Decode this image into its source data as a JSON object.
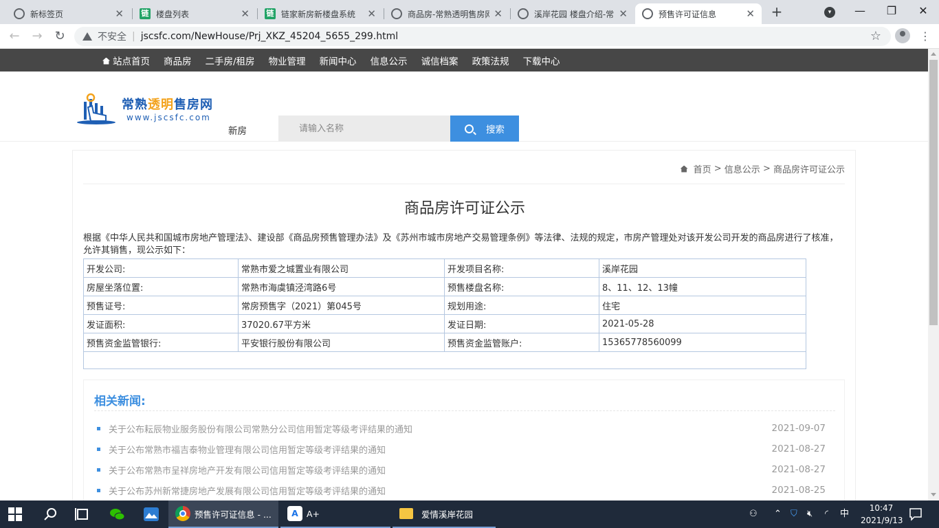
{
  "browser": {
    "tabs": [
      {
        "title": "新标签页",
        "favicon": "chrome-icon"
      },
      {
        "title": "楼盘列表",
        "favicon": "sheet-icon"
      },
      {
        "title": "链家新房新楼盘系统",
        "favicon": "sheet-icon"
      },
      {
        "title": "商品房-常熟透明售房网",
        "favicon": "globe-icon"
      },
      {
        "title": "溪岸花园 楼盘介绍-常",
        "favicon": "globe-icon"
      },
      {
        "title": "预售许可证信息",
        "favicon": "globe-icon"
      }
    ],
    "new_tab_label": "+",
    "security_label": "不安全",
    "url": "jscsfc.com/NewHouse/Prj_XKZ_45204_5655_299.html"
  },
  "site": {
    "nav": [
      "站点首页",
      "商品房",
      "二手房/租房",
      "物业管理",
      "新闻中心",
      "信息公示",
      "诚信档案",
      "政策法规",
      "下载中心"
    ],
    "title_a": "常熟",
    "title_b": "透明",
    "title_c": "售房网",
    "url_text": "www.jscsfc.com",
    "subtitle": "新房",
    "search_placeholder": "请输入名称",
    "search_button": "搜索",
    "accent": "#3d8fe0"
  },
  "breadcrumb": [
    "首页",
    "信息公示",
    "商品房许可证公示"
  ],
  "page_title": "商品房许可证公示",
  "intro": "根据《中华人民共和国城市房地产管理法》、建设部《商品房预售管理办法》及《苏州市城市房地产交易管理条例》等法律、法规的规定，市房产管理处对该开发公司开发的商品房进行了核准，允许其销售，现公示如下：",
  "permit": [
    [
      "开发公司:",
      "常熟市爱之城置业有限公司",
      "开发项目名称:",
      "溪岸花园"
    ],
    [
      "房屋坐落位置:",
      "常熟市海虞镇泾湾路6号",
      "预售楼盘名称:",
      "8、11、12、13幢"
    ],
    [
      "预售证号:",
      "常房预售字（2021）第045号",
      "规划用途:",
      "住宅"
    ],
    [
      "发证面积:",
      "37020.67平方米",
      "发证日期:",
      "2021-05-28"
    ],
    [
      "预售资金监管银行:",
      "平安银行股份有限公司",
      "预售资金监管账户:",
      "15365778560099"
    ]
  ],
  "related": {
    "title": "相关新闻:",
    "items": [
      {
        "title": "关于公布耘辰物业服务股份有限公司常熟分公司信用暂定等级考评结果的通知",
        "date": "2021-09-07"
      },
      {
        "title": "关于公布常熟市福吉泰物业管理有限公司信用暂定等级考评结果的通知",
        "date": "2021-08-27"
      },
      {
        "title": "关于公布常熟市呈祥房地产开发有限公司信用暂定等级考评结果的通知",
        "date": "2021-08-27"
      },
      {
        "title": "关于公布苏州新常捷房地产发展有限公司信用暂定等级考评结果的通知",
        "date": "2021-08-25"
      }
    ]
  },
  "taskbar": {
    "apps": [
      {
        "label": "预售许可证信息 - ..."
      },
      {
        "label": "A+"
      },
      {
        "label": "爱情溪岸花园"
      }
    ],
    "ime": "中",
    "time": "10:47",
    "date": "2021/9/13"
  }
}
